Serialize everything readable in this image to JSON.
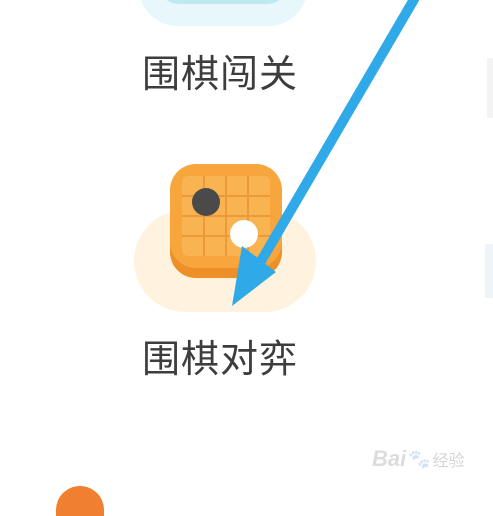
{
  "menu": {
    "items": [
      {
        "label": "围棋闯关",
        "icon": "go-level-icon"
      },
      {
        "label": "围棋对弈",
        "icon": "go-board-icon"
      }
    ]
  },
  "annotation": {
    "type": "arrow",
    "color": "#2fa9e8"
  },
  "colors": {
    "label_text": "#3d3d3d",
    "board_orange": "#f6a63c",
    "board_shadow": "#ee8f27",
    "glow": "#fff3df",
    "black_stone": "#4a4a4a",
    "white_stone": "#ffffff"
  },
  "watermark": {
    "brand": "Bai",
    "paw": "🐾",
    "suffix": "经验"
  }
}
